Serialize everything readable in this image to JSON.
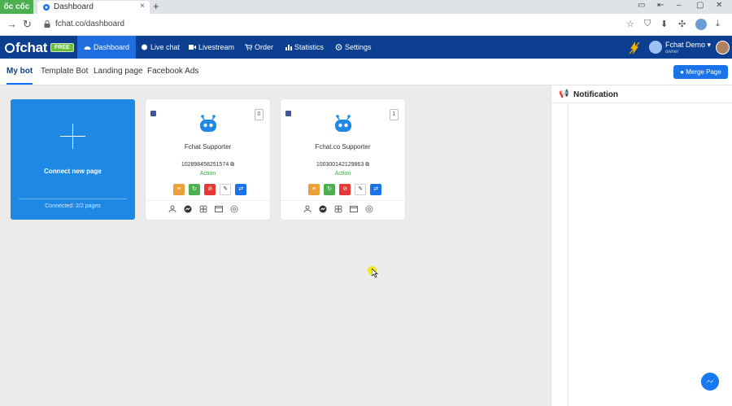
{
  "browser": {
    "brand": "ốc cốc",
    "tab_title": "Dashboard",
    "tab_close": "×",
    "new_tab": "+",
    "url": "fchat.co/dashboard"
  },
  "app": {
    "logo": "fchat",
    "badge": "FREE",
    "nav": [
      {
        "label": "Dashboard",
        "icon": "dashboard-icon"
      },
      {
        "label": "Live chat",
        "icon": "chat-icon"
      },
      {
        "label": "Livestream",
        "icon": "video-icon"
      },
      {
        "label": "Order",
        "icon": "cart-icon"
      },
      {
        "label": "Statistics",
        "icon": "bar-chart-icon"
      },
      {
        "label": "Settings",
        "icon": "gear-icon"
      }
    ],
    "user": {
      "name": "Fchat Demo ▾",
      "role": "owner"
    }
  },
  "subnav": {
    "tabs": [
      "My bot",
      "Template Bot",
      "Landing page",
      "Facebook Ads"
    ],
    "merge_button": "Merge Page"
  },
  "connect_card": {
    "label": "Connect new page",
    "status": "Connected: 2/2 pages"
  },
  "pages": [
    {
      "name": "Fchat Supporter",
      "page_id": "102898458251574",
      "action": "Action",
      "count": "0"
    },
    {
      "name": "Fchat.co Supporter",
      "page_id": "100300142129863",
      "action": "Action",
      "count": "1"
    }
  ],
  "notification": {
    "title": "Notification"
  },
  "colors": {
    "header": "#0d3f91",
    "active_nav": "#1e6ee0",
    "connect_card": "#1e88e5",
    "action_text": "#43a047",
    "free_badge": "#6abf3a"
  }
}
